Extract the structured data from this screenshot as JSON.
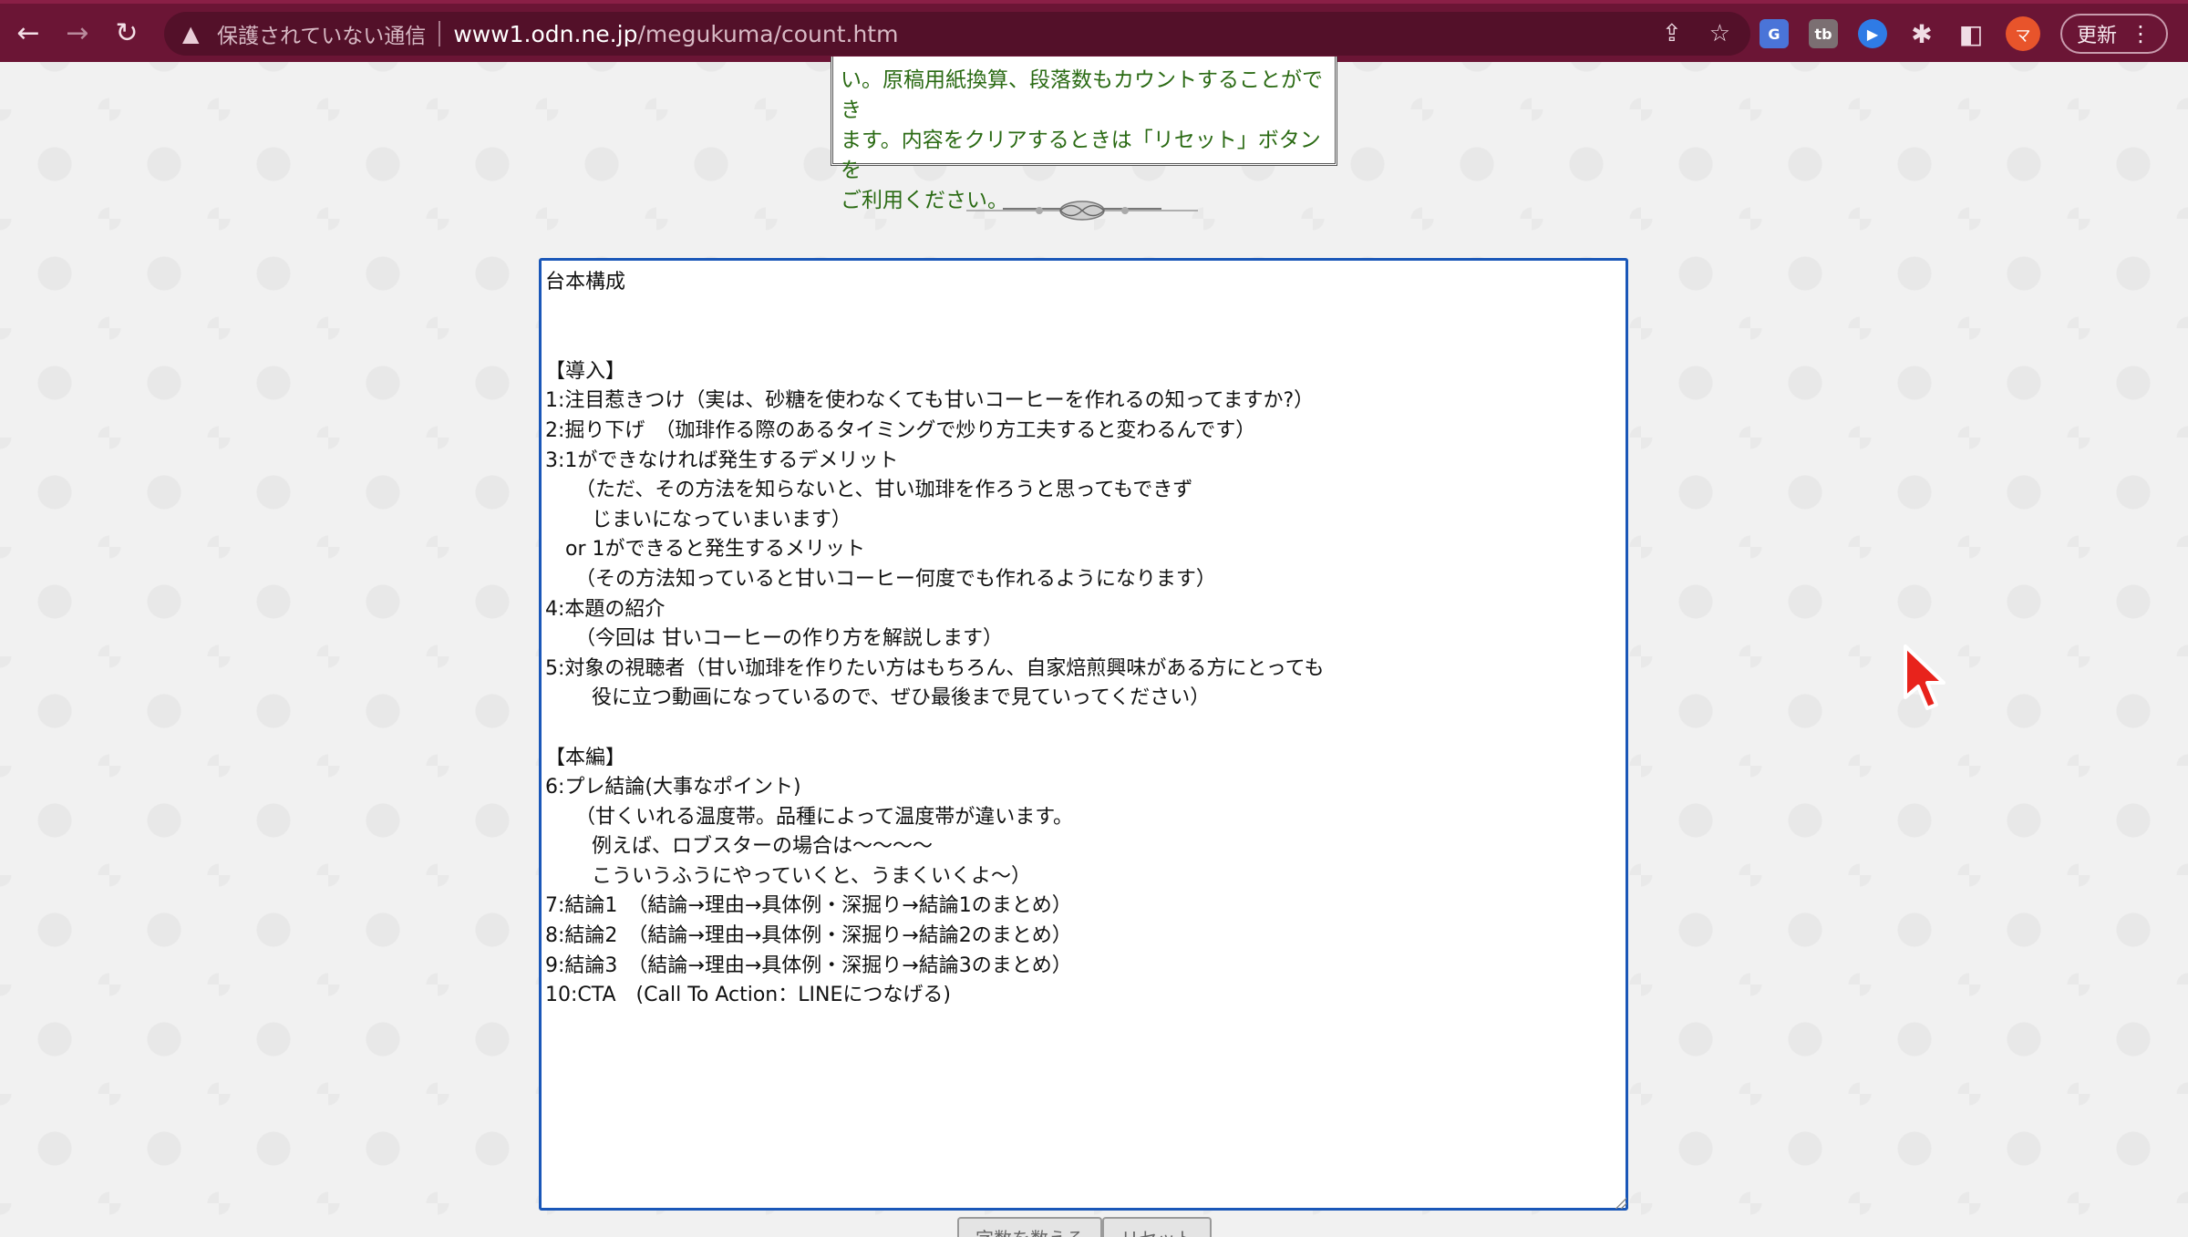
{
  "browser": {
    "security_text": "保護されていない通信",
    "url_host": "www1.odn.ne.jp",
    "url_path": "/megukuma/count.htm",
    "update_label": "更新",
    "avatar_initial": "マ",
    "icons": {
      "back": "back-arrow-icon",
      "forward": "forward-arrow-icon",
      "reload": "reload-icon",
      "warning": "warning-icon",
      "share": "share-icon",
      "bookmark": "star-icon",
      "extensions": "puzzle-icon",
      "side_panel": "side-panel-icon",
      "menu": "kebab-menu-icon"
    },
    "ext_labels": {
      "translate": "G",
      "tb": "tb",
      "circle": "▶"
    }
  },
  "info": {
    "lines": [
      "い。原稿用紙換算、段落数もカウントすることができ",
      "ます。内容をクリアするときは「リセット」ボタンを",
      "ご利用ください。"
    ]
  },
  "editor": {
    "text": "台本構成\n\n\n【導入】\n1:注目惹きつけ（実は、砂糖を使わなくても甘いコーヒーを作れるの知ってますか?）\n2:掘り下げ　（珈琲作る際のあるタイミングで炒り方工夫すると変わるんです）\n3:1ができなければ発生するデメリット\n　　（ただ、その方法を知らないと、甘い珈琲を作ろうと思ってもできず\n　　 じまいになっていまいます）\n　or 1ができると発生するメリット\n　　（その方法知っていると甘いコーヒー何度でも作れるようになります）\n4:本題の紹介\n　　（今回は 甘いコーヒーの作り方を解説します）\n5:対象の視聴者（甘い珈琲を作りたい方はもちろん、自家焙煎興味がある方にとっても\n　　 役に立つ動画になっているので、ぜひ最後まで見ていってください）\n\n【本編】\n6:プレ結論(大事なポイント)\n　　（甘くいれる温度帯。品種によって温度帯が違います。\n　　 例えば、ロブスターの場合は〜〜〜〜\n　　 こういうふうにやっていくと、うまくいくよ〜）\n7:結論1　（結論→理由→具体例・深掘り→結論1のまとめ）\n8:結論2　（結論→理由→具体例・深掘り→結論2のまとめ）\n9:結論3　（結論→理由→具体例・深掘り→結論3のまとめ）\n10:CTA　(Call To Action：LINEにつなげる)"
  },
  "buttons": {
    "count_label": "字数を数える",
    "reset_label": "リセット"
  },
  "colors": {
    "browser_frame": "#6b1535",
    "info_text": "#2a6a13",
    "editor_border": "#1a57b8"
  }
}
